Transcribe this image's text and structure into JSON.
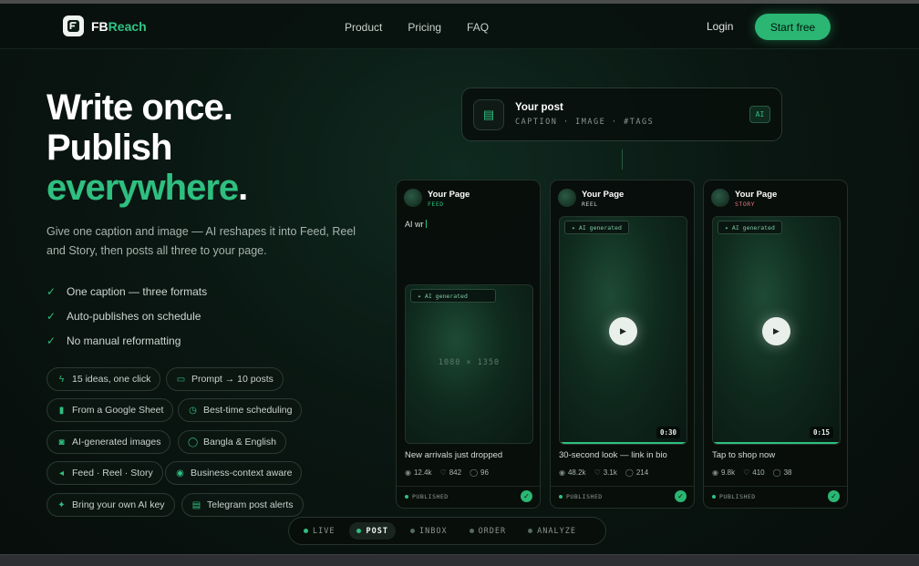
{
  "brand": {
    "name_prefix": "FB",
    "name_suffix": "Reach",
    "accent": "#2bb673"
  },
  "nav": {
    "links": [
      "Product",
      "Pricing",
      "FAQ"
    ],
    "login": "Login",
    "cta": "Start free"
  },
  "hero": {
    "line1": "Write once.",
    "line2": "Publish",
    "line3": "everywhere",
    "period": ".",
    "subtitle": "Give one caption and image — AI reshapes it into Feed, Reel and Story, then posts all three to your page."
  },
  "checks": [
    "One caption — three formats",
    "Auto-publishes on schedule",
    "No manual reformatting"
  ],
  "chips": [
    {
      "label": "15 ideas, one click",
      "icon": "bolt-icon"
    },
    {
      "label": "Prompt → 10 posts",
      "icon": "prompt-icon"
    },
    {
      "label": "From a Google Sheet",
      "icon": "chart-icon"
    },
    {
      "label": "Best-time scheduling",
      "icon": "clock-icon"
    },
    {
      "label": "AI-generated images",
      "icon": "camera-icon"
    },
    {
      "label": "Bangla & English",
      "icon": "chat-icon"
    },
    {
      "label": "Feed · Reel · Story",
      "icon": "megaphone-icon"
    },
    {
      "label": "Business-context aware",
      "icon": "eye-icon"
    },
    {
      "label": "Bring your own AI key",
      "icon": "sparkle-icon"
    },
    {
      "label": "Telegram post alerts",
      "icon": "message-icon"
    }
  ],
  "post": {
    "title": "Your post",
    "meta": "CAPTION · IMAGE · #TAGS",
    "badge": "AI"
  },
  "cards": [
    {
      "page": "Your Page",
      "type": "FEED",
      "type_color": "#2fbf80",
      "typing": "AI wr",
      "gen": "AI generated",
      "dims": "1080 × 1350",
      "caption": "New arrivals just dropped",
      "views": "12.4k",
      "likes": "842",
      "comments": "96",
      "status": "PUBLISHED"
    },
    {
      "page": "Your Page",
      "type": "REEL",
      "type_color": "#c9d2cd",
      "gen": "AI generated",
      "duration": "0:30",
      "progress": 1.0,
      "caption": "30-second look — link in bio",
      "views": "48.2k",
      "likes": "3.1k",
      "comments": "214",
      "status": "PUBLISHED"
    },
    {
      "page": "Your Page",
      "type": "STORY",
      "type_color": "#e0737b",
      "gen": "AI generated",
      "duration": "0:15",
      "progress": 1.0,
      "caption": "Tap to shop now",
      "views": "9.8k",
      "likes": "410",
      "comments": "38",
      "status": "PUBLISHED"
    }
  ],
  "tabs": [
    {
      "label": "LIVE",
      "active": false
    },
    {
      "label": "POST",
      "active": true
    },
    {
      "label": "INBOX",
      "active": false
    },
    {
      "label": "ORDER",
      "active": false
    },
    {
      "label": "ANALYZE",
      "active": false
    }
  ]
}
